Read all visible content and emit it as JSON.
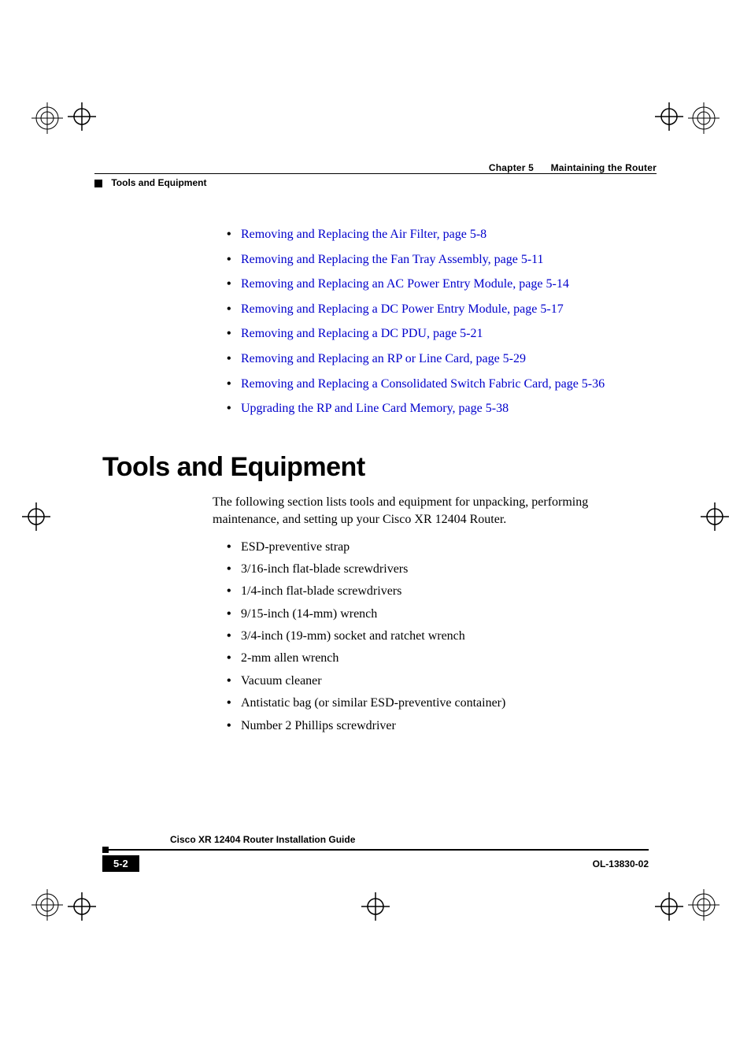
{
  "header": {
    "chapter_label": "Chapter 5",
    "chapter_title": "Maintaining the Router",
    "section_title": "Tools and Equipment"
  },
  "links": [
    "Removing and Replacing the Air Filter, page 5-8",
    "Removing and Replacing the Fan Tray Assembly, page 5-11",
    "Removing and Replacing an AC Power Entry Module, page 5-14",
    "Removing and Replacing a DC Power Entry Module, page 5-17",
    "Removing and Replacing a DC PDU, page 5-21",
    "Removing and Replacing an RP or Line Card, page 5-29",
    "Removing and Replacing a Consolidated Switch Fabric Card, page 5-36",
    "Upgrading the RP and Line Card Memory, page 5-38"
  ],
  "heading": "Tools and Equipment",
  "intro_text": "The following section lists tools and equipment for unpacking, performing maintenance, and setting up your Cisco XR 12404 Router.",
  "equipment": [
    "ESD-preventive strap",
    "3/16-inch flat-blade screwdrivers",
    "1/4-inch flat-blade screwdrivers",
    "9/15-inch (14-mm) wrench",
    "3/4-inch (19-mm) socket and ratchet wrench",
    "2-mm allen wrench",
    "Vacuum cleaner",
    "Antistatic bag (or similar ESD-preventive container)",
    "Number 2 Phillips screwdriver"
  ],
  "footer": {
    "doc_title": "Cisco XR 12404 Router Installation Guide",
    "page_number": "5-2",
    "doc_id": "OL-13830-02"
  }
}
